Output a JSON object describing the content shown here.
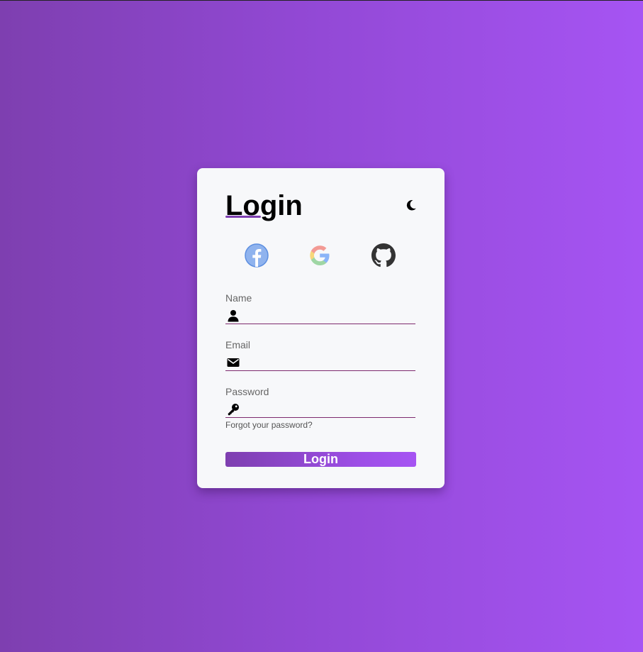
{
  "login_card": {
    "title": "Login",
    "theme_toggle_icon": "moon-icon",
    "social_buttons": [
      {
        "icon": "facebook-icon",
        "color": "#1877f2"
      },
      {
        "icon": "google-icon",
        "color": "#4285f4"
      },
      {
        "icon": "github-icon",
        "color": "#333333"
      }
    ],
    "fields": {
      "name": {
        "label": "Name",
        "icon": "user-icon",
        "value": "",
        "placeholder": ""
      },
      "email": {
        "label": "Email",
        "icon": "envelope-icon",
        "value": "",
        "placeholder": ""
      },
      "password": {
        "label": "Password",
        "icon": "key-icon",
        "value": "",
        "placeholder": ""
      }
    },
    "forgot_password_link": "Forgot your password?",
    "submit_label": "Login"
  },
  "colors": {
    "background_start": "#7e3fb0",
    "background_end": "#a654f3",
    "card_background": "#f7f8fa",
    "field_underline": "#7e2a6e",
    "accent": "#7e3fb0"
  }
}
